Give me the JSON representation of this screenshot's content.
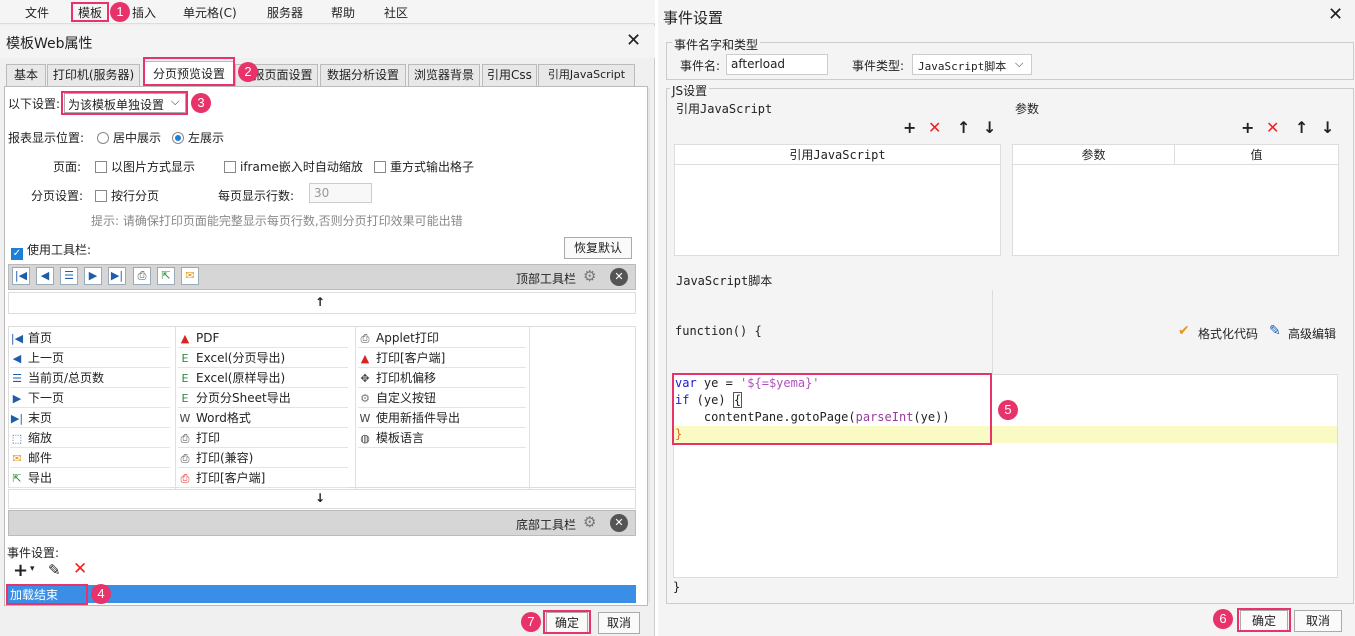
{
  "menu": {
    "file": "文件",
    "template": "模板",
    "insert": "插入",
    "cell": "单元格(C)",
    "server": "服务器",
    "help": "帮助",
    "community": "社区"
  },
  "left_dialog": {
    "title": "模板Web属性",
    "close": "✕",
    "tabs": [
      "基本",
      "打印机(服务器)",
      "分页预览设置",
      "填报页面设置",
      "数据分析设置",
      "浏览器背景",
      "引用Css",
      "引用JavaScript"
    ],
    "settings_label": "以下设置:",
    "settings_value": "为该模板单独设置",
    "report_pos_label": "报表显示位置:",
    "center": "居中展示",
    "left": "左展示",
    "page_label": "页面:",
    "as_image": "以图片方式显示",
    "iframe": "iframe嵌入时自动缩放",
    "repeat": "重方式输出格子",
    "pagination_label": "分页设置:",
    "by_row": "按行分页",
    "rows_per_page_label": "每页显示行数:",
    "rows_per_page": "30",
    "hint": "提示: 请确保打印页面能完整显示每页行数,否则分页打印效果可能出错",
    "use_toolbar": "使用工具栏:",
    "restore": "恢复默认",
    "top_toolbar": "顶部工具栏",
    "bottom_toolbar": "底部工具栏",
    "up_arrow": "↑",
    "down_arrow": "↓",
    "col1": [
      "首页",
      "上一页",
      "当前页/总页数",
      "下一页",
      "末页",
      "缩放",
      "邮件",
      "导出"
    ],
    "col2": [
      "PDF",
      "Excel(分页导出)",
      "Excel(原样导出)",
      "分页分Sheet导出",
      "Word格式",
      "打印",
      "打印(兼容)",
      "打印[客户端]"
    ],
    "col3": [
      "Applet打印",
      "打印[客户端]",
      "打印机偏移",
      "自定义按钮",
      "使用新插件导出",
      "模板语言"
    ],
    "event_label": "事件设置:",
    "event_item": "加载结束",
    "ok": "确定",
    "cancel": "取消"
  },
  "badges": [
    "1",
    "2",
    "3",
    "4",
    "5",
    "6",
    "7"
  ],
  "right_dialog": {
    "title": "事件设置",
    "close": "✕",
    "name_type_legend": "事件名字和类型",
    "event_name_label": "事件名:",
    "event_name": "afterload",
    "event_type_label": "事件类型:",
    "event_type": "JavaScript脚本",
    "js_legend": "JS设置",
    "ref_js_legend": "引用JavaScript",
    "params_legend": "参数",
    "ref_js_header": "引用JavaScript",
    "param_header": "参数",
    "value_header": "值",
    "script_legend": "JavaScript脚本",
    "func_open": "function() {",
    "func_close": "}",
    "format_code": "格式化代码",
    "advanced_edit": "高级编辑",
    "code_lines": [
      "var ye = '${=$yema}'",
      "if (ye) {",
      "    contentPane.gotoPage(parseInt(ye))",
      "}"
    ],
    "ok": "确定",
    "cancel": "取消"
  }
}
